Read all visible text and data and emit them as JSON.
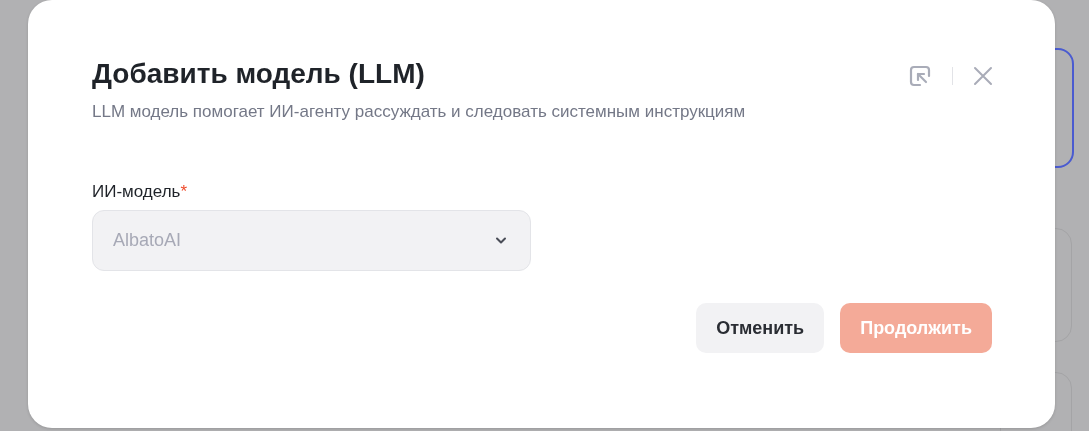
{
  "dialog": {
    "title": "Добавить модель (LLM)",
    "subtitle": "LLM модель помогает ИИ-агенту рассуждать и следовать системным инструкциям",
    "field": {
      "label": "ИИ-модель",
      "required_mark": "*",
      "value": "AlbatoAI",
      "disabled": true
    },
    "buttons": [
      {
        "kind": "secondary",
        "label": "Отменить",
        "disabled": false
      },
      {
        "kind": "primary",
        "label": "Продолжить",
        "disabled": true
      }
    ]
  }
}
